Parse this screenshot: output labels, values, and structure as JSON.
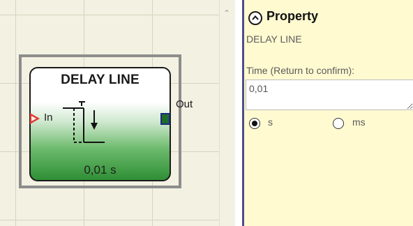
{
  "canvas": {
    "block": {
      "title": "DELAY LINE",
      "value": "0,01 s",
      "input_label": "In",
      "output_label": "Out"
    }
  },
  "property_panel": {
    "title": "Property",
    "subtitle": "DELAY LINE",
    "time_label": "Time (Return to confirm):",
    "time_value": "0,01",
    "unit_options": [
      {
        "label": "s",
        "selected": true
      },
      {
        "label": "ms",
        "selected": false
      }
    ]
  },
  "colors": {
    "canvas_background": "#f3f1e2",
    "panel_background": "#fffad0",
    "input_pin": "#e53935",
    "output_pin": "#1f6b2a",
    "block_gradient_bottom": "#2f8f35",
    "divider": "#4b4f8c"
  },
  "icons": {
    "collapse": "chevron-up-icon",
    "scroll_up": "scroll-up-arrow-icon",
    "block_symbol": "delay-line-icon"
  }
}
